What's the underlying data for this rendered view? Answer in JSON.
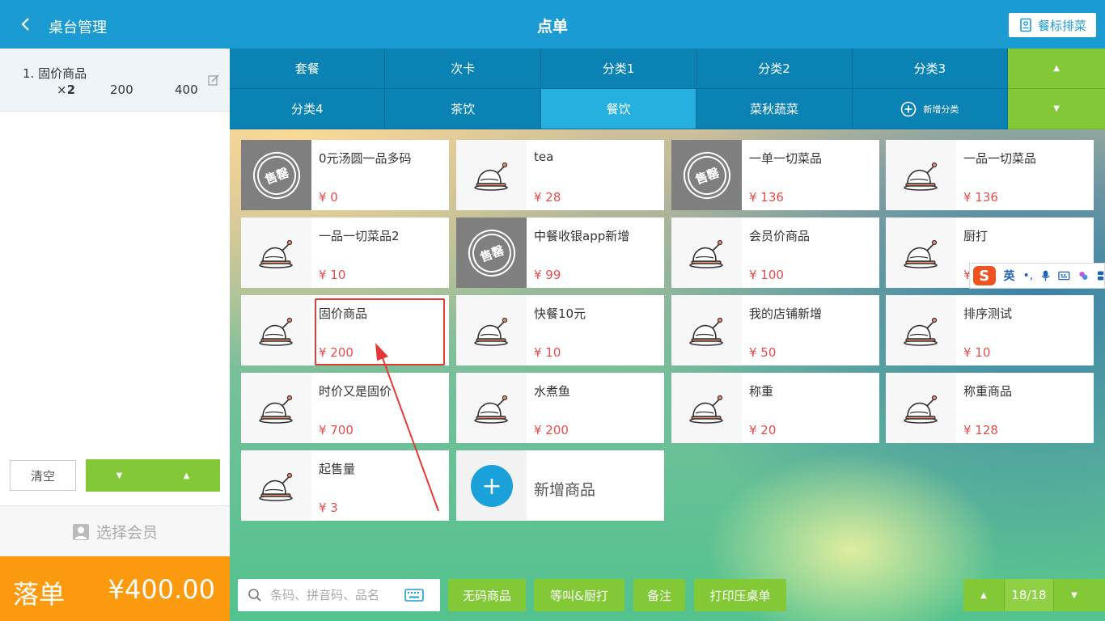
{
  "header": {
    "back_label": "桌台管理",
    "title": "点单",
    "mark_button": "餐标排菜"
  },
  "order": {
    "items": [
      {
        "name": "1. 固价商品",
        "qty_prefix": "×",
        "qty": "2",
        "price": "200",
        "total": "400"
      }
    ],
    "clear_label": "清空",
    "member_label": "选择会员",
    "submit_label": "落单",
    "submit_total": "¥400.00"
  },
  "categories": {
    "row1": [
      "套餐",
      "次卡",
      "分类1",
      "分类2",
      "分类3"
    ],
    "row2": [
      "分类4",
      "茶饮",
      "餐饮",
      "菜秋蔬菜"
    ],
    "add_label": "新增分类",
    "active": "餐饮"
  },
  "products": [
    {
      "name": "0元汤圆一品多码",
      "price": "¥ 0",
      "sold_out": true
    },
    {
      "name": "tea",
      "price": "¥ 28",
      "sold_out": false
    },
    {
      "name": "一单一切菜品",
      "price": "¥ 136",
      "sold_out": true
    },
    {
      "name": "一品一切菜品",
      "price": "¥ 136",
      "sold_out": false
    },
    {
      "name": "一品一切菜品2",
      "price": "¥ 10",
      "sold_out": false
    },
    {
      "name": "中餐收银app新增",
      "price": "¥ 99",
      "sold_out": true
    },
    {
      "name": "会员价商品",
      "price": "¥ 100",
      "sold_out": false
    },
    {
      "name": "厨打",
      "price": "¥",
      "sold_out": false
    },
    {
      "name": "固价商品",
      "price": "¥ 200",
      "sold_out": false
    },
    {
      "name": "快餐10元",
      "price": "¥ 10",
      "sold_out": false
    },
    {
      "name": "我的店铺新增",
      "price": "¥ 50",
      "sold_out": false
    },
    {
      "name": "排序测试",
      "price": "¥ 10",
      "sold_out": false
    },
    {
      "name": "时价又是固价",
      "price": "¥ 700",
      "sold_out": false
    },
    {
      "name": "水煮鱼",
      "price": "¥ 200",
      "sold_out": false
    },
    {
      "name": "称重",
      "price": "¥ 20",
      "sold_out": false
    },
    {
      "name": "称重商品",
      "price": "¥ 128",
      "sold_out": false
    },
    {
      "name": "起售量",
      "price": "¥ 3",
      "sold_out": false
    }
  ],
  "sold_badge": "售罄",
  "add_product_label": "新增商品",
  "ime": {
    "logo": "S",
    "mode": "英",
    "punct": "•,"
  },
  "bottom": {
    "search_placeholder": "条码、拼音码、品名",
    "buttons": [
      "无码商品",
      "等叫&厨打",
      "备注",
      "打印压桌单"
    ],
    "page": "18/18"
  },
  "colors": {
    "header_blue": "#1a9bd1",
    "category_blue": "#0b82b4",
    "category_active": "#25b0e0",
    "green": "#82c837",
    "orange": "#fb9a0f",
    "price_red": "#e84b4b",
    "annotation_red": "#e53935"
  }
}
